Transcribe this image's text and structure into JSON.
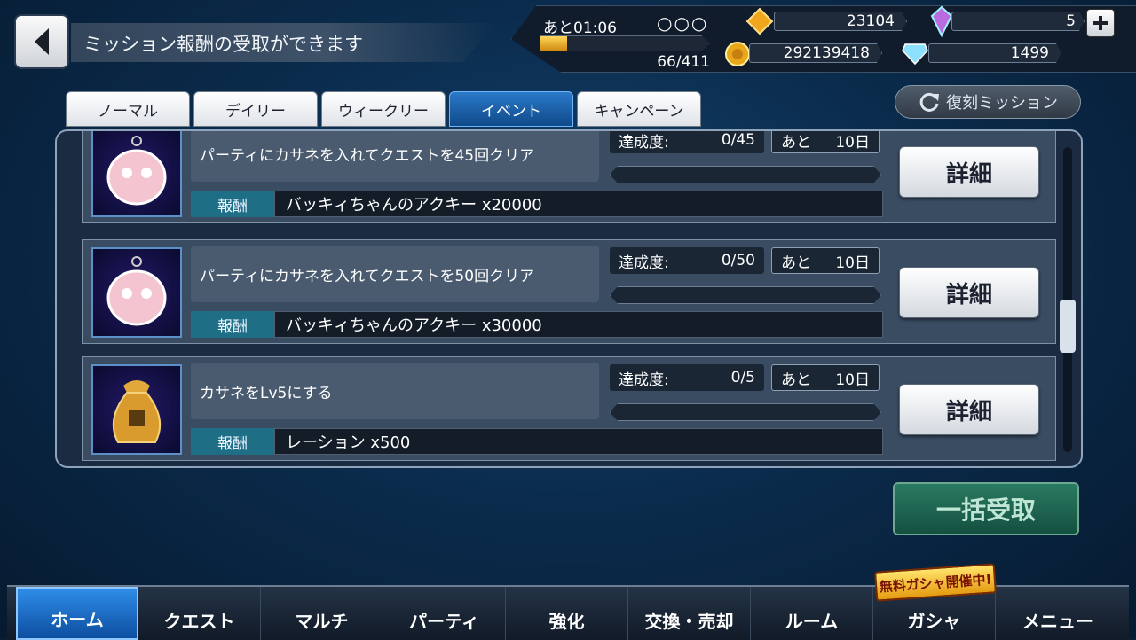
{
  "header": {
    "title": "ミッション報酬の受取ができます"
  },
  "status": {
    "stamina_timer": "あと01:06",
    "stamina_dots": "○○○",
    "stamina_value": "66/411",
    "stamina_fraction": 0.16,
    "gold_crystal": "23104",
    "rainbow_crystal": "5",
    "coins": "292139418",
    "diamonds": "1499"
  },
  "tabs": [
    {
      "label": "ノーマル",
      "active": false
    },
    {
      "label": "デイリー",
      "active": false
    },
    {
      "label": "ウィークリー",
      "active": false
    },
    {
      "label": "イベント",
      "active": true
    },
    {
      "label": "キャンペーン",
      "active": false
    }
  ],
  "revival_button": "復刻ミッション",
  "missions": [
    {
      "name": "パーティにカサネを入れてクエストを45回クリア",
      "progress_label": "達成度:",
      "progress": "0/45",
      "remain_label": "あと",
      "remain": "10日",
      "reward_label": "報酬",
      "reward": "バッキィちゃんのアクキー x20000",
      "detail_label": "詳細",
      "icon": "keychain-icon"
    },
    {
      "name": "パーティにカサネを入れてクエストを50回クリア",
      "progress_label": "達成度:",
      "progress": "0/50",
      "remain_label": "あと",
      "remain": "10日",
      "reward_label": "報酬",
      "reward": "バッキィちゃんのアクキー x30000",
      "detail_label": "詳細",
      "icon": "keychain-icon"
    },
    {
      "name": "カサネをLv5にする",
      "progress_label": "達成度:",
      "progress": "0/5",
      "remain_label": "あと",
      "remain": "10日",
      "reward_label": "報酬",
      "reward": "レーション x500",
      "detail_label": "詳細",
      "icon": "ration-bag-icon"
    }
  ],
  "bulk_receive": "一括受取",
  "gacha_badge": "無料ガシャ開催中!",
  "nav": [
    {
      "label": "ホーム",
      "active": true
    },
    {
      "label": "クエスト",
      "active": false
    },
    {
      "label": "マルチ",
      "active": false
    },
    {
      "label": "パーティ",
      "active": false
    },
    {
      "label": "強化",
      "active": false
    },
    {
      "label": "交換・売却",
      "active": false
    },
    {
      "label": "ルーム",
      "active": false
    },
    {
      "label": "ガシャ",
      "active": false
    },
    {
      "label": "メニュー",
      "active": false
    }
  ],
  "colors": {
    "accent_blue": "#2b79c9",
    "bulk_green": "#2a7a62",
    "reward_teal": "#1e6e86"
  }
}
